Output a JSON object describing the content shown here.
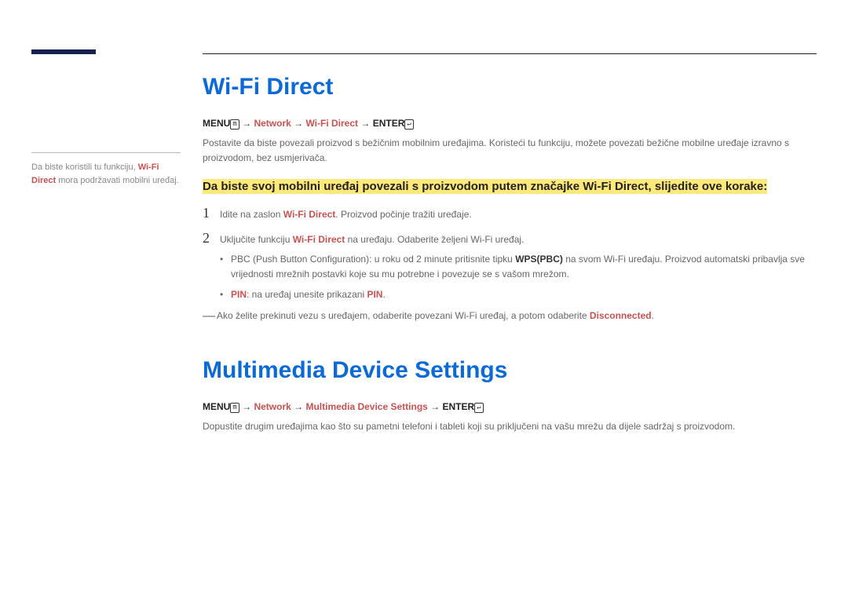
{
  "accentColor": "#0b6ad6",
  "sidebar": {
    "note_pre": "Da biste koristili tu funkciju, ",
    "note_accent": "Wi-Fi Direct",
    "note_post": " mora podržavati mobilni uređaj."
  },
  "section1": {
    "title": "Wi-Fi Direct",
    "nav": {
      "menu": "MENU",
      "menu_icon": "m",
      "arrow": " → ",
      "network": "Network",
      "wifi": "Wi-Fi Direct",
      "enter": "ENTER",
      "enter_icon": "↵"
    },
    "desc": "Postavite da biste povezali proizvod s bežičnim mobilnim uređajima. Koristeći tu funkciju, možete povezati bežične mobilne uređaje izravno s proizvodom, bez usmjerivača.",
    "highlight": "Da biste svoj mobilni uređaj povezali s proizvodom putem značajke Wi-Fi Direct, slijedite ove korake:",
    "steps": [
      {
        "num": "1",
        "pre": "Idite na zaslon ",
        "accent": "Wi-Fi Direct",
        "post": ". Proizvod počinje tražiti uređaje."
      },
      {
        "num": "2",
        "pre": "Uključite funkciju ",
        "accent": "Wi-Fi Direct",
        "post": " na uređaju. Odaberite željeni Wi-Fi uređaj."
      }
    ],
    "sub": [
      {
        "pre": "PBC (Push Button Configuration): u roku od 2 minute pritisnite tipku ",
        "bold1": "WPS(PBC)",
        "post": " na svom Wi-Fi uređaju. Proizvod automatski pribavlja sve vrijednosti mrežnih postavki koje su mu potrebne i povezuje se s vašom mrežom."
      },
      {
        "label": "PIN",
        "mid": ": na uređaj unesite prikazani ",
        "pin": "PIN",
        "end": "."
      }
    ],
    "note_pre": "Ako želite prekinuti vezu s uređajem, odaberite povezani Wi-Fi uređaj, a potom odaberite ",
    "note_accent": "Disconnected",
    "note_post": "."
  },
  "section2": {
    "title": "Multimedia Device Settings",
    "nav": {
      "menu": "MENU",
      "menu_icon": "m",
      "arrow": " → ",
      "network": "Network",
      "mds": "Multimedia Device Settings",
      "enter": "ENTER",
      "enter_icon": "↵"
    },
    "desc": "Dopustite drugim uređajima kao što su pametni telefoni i tableti koji su priključeni na vašu mrežu da dijele sadržaj s proizvodom."
  }
}
